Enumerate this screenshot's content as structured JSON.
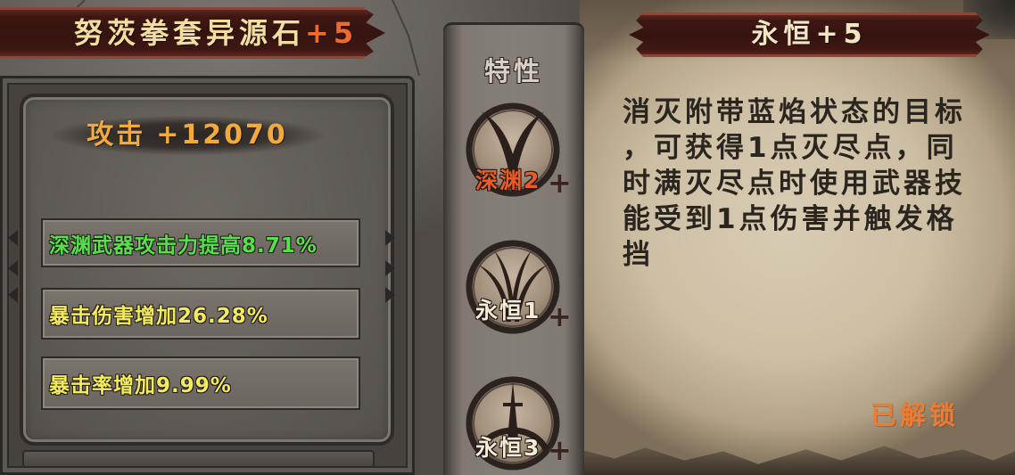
{
  "equipment": {
    "name": "努茨拳套异源石",
    "level": "+5",
    "attack_label": "攻击",
    "attack_value": "+12070",
    "stats": [
      {
        "text": "深渊武器攻击力提高8.71%",
        "color": "#58e04c"
      },
      {
        "text": "暴击伤害增加26.28%",
        "color": "#f4eb5c"
      },
      {
        "text": "暴击率增加9.99%",
        "color": "#f4eb5c"
      }
    ]
  },
  "traits": {
    "header": "特性",
    "add_symbol": "+",
    "items": [
      {
        "label": "深渊2",
        "icon": "abyss-emblem-icon",
        "color": "#ee5a22"
      },
      {
        "label": "永恒1",
        "icon": "eternal-claw-icon",
        "color": "#f4ecd6"
      },
      {
        "label": "永恒3",
        "icon": "eternal-spire-icon",
        "color": "#f4ecd6"
      }
    ]
  },
  "detail": {
    "title": "永恒+5",
    "description_lines": [
      "消灭附带蓝焰状态的目标",
      "，可获得1点灭尽点，同",
      "时满灭尽点时使用武器技",
      "能受到1点伤害并触发格",
      "挡"
    ],
    "status": "已解锁"
  },
  "colors": {
    "title_text": "#f2dfa0",
    "level_text": "#ef6b2d",
    "attack_text": "#f3aa3b",
    "header_text": "#d9d1c6",
    "detail_title_text": "#f3e6c4",
    "description_text": "#2b2520",
    "status_text": "#ec7b33"
  }
}
